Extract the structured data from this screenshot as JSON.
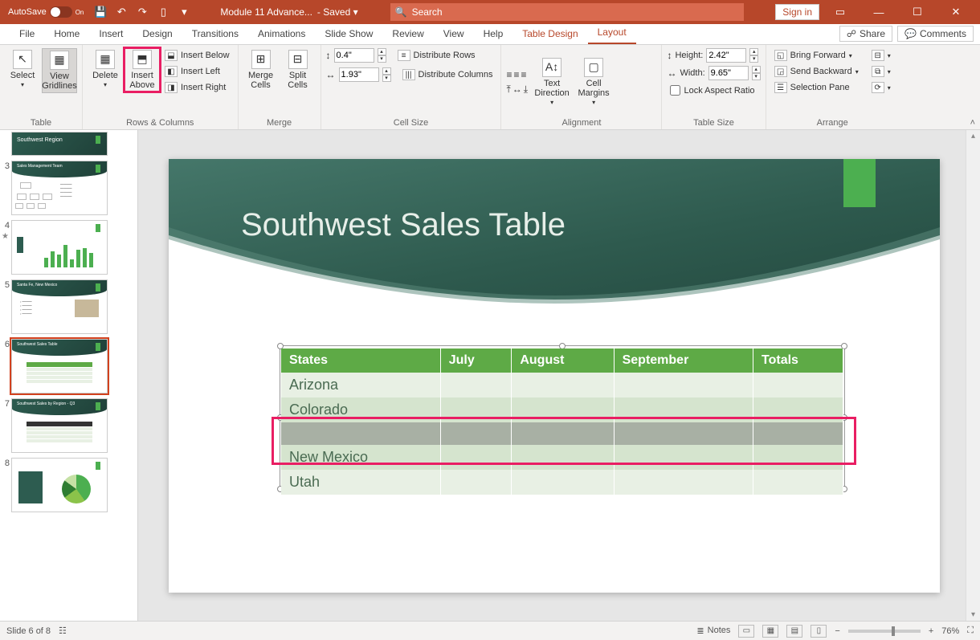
{
  "titlebar": {
    "autosave_label": "AutoSave",
    "autosave_state": "On",
    "doc_name": "Module 11 Advance...",
    "save_state": "- Saved ▾",
    "search_placeholder": "Search",
    "sign_in": "Sign in"
  },
  "tabs": {
    "items": [
      "File",
      "Home",
      "Insert",
      "Design",
      "Transitions",
      "Animations",
      "Slide Show",
      "Review",
      "View",
      "Help",
      "Table Design",
      "Layout"
    ],
    "active": "Layout",
    "share": "Share",
    "comments": "Comments"
  },
  "ribbon": {
    "table": {
      "select": "Select",
      "view_gridlines": "View Gridlines",
      "label": "Table"
    },
    "rows_cols": {
      "delete": "Delete",
      "insert_above": "Insert Above",
      "insert_below": "Insert Below",
      "insert_left": "Insert Left",
      "insert_right": "Insert Right",
      "label": "Rows & Columns"
    },
    "merge": {
      "merge": "Merge Cells",
      "split": "Split Cells",
      "label": "Merge"
    },
    "cell_size": {
      "height": "0.4\"",
      "width": "1.93\"",
      "dist_rows": "Distribute Rows",
      "dist_cols": "Distribute Columns",
      "label": "Cell Size"
    },
    "alignment": {
      "text_dir": "Text Direction",
      "cell_margins": "Cell Margins",
      "label": "Alignment"
    },
    "table_size": {
      "height_label": "Height:",
      "height": "2.42\"",
      "width_label": "Width:",
      "width": "9.65\"",
      "lock": "Lock Aspect Ratio",
      "label": "Table Size"
    },
    "arrange": {
      "bring_fwd": "Bring Forward",
      "send_back": "Send Backward",
      "sel_pane": "Selection Pane",
      "label": "Arrange"
    }
  },
  "thumbs": [
    {
      "num": "",
      "type": "dark-title",
      "title": "Southwest Region"
    },
    {
      "num": "3",
      "type": "org",
      "title": "Sales Management Team"
    },
    {
      "num": "4",
      "type": "chart",
      "star": true,
      "title": ""
    },
    {
      "num": "5",
      "type": "info",
      "title": "Santa Fe, New Mexico"
    },
    {
      "num": "6",
      "type": "table",
      "selected": true,
      "title": "Southwest Sales Table"
    },
    {
      "num": "7",
      "type": "table2",
      "title": "Southwest Sales by Region - Q3"
    },
    {
      "num": "8",
      "type": "pie",
      "title": ""
    }
  ],
  "slide": {
    "title": "Southwest Sales Table",
    "columns": [
      "States",
      "July",
      "August",
      "September",
      "Totals"
    ],
    "rows": [
      {
        "cells": [
          "Arizona",
          "",
          "",
          "",
          ""
        ],
        "band": "light"
      },
      {
        "cells": [
          "Colorado",
          "",
          "",
          "",
          ""
        ],
        "band": "dark"
      },
      {
        "cells": [
          "",
          "",
          "",
          "",
          ""
        ],
        "band": "sel"
      },
      {
        "cells": [
          "New Mexico",
          "",
          "",
          "",
          ""
        ],
        "band": "dark"
      },
      {
        "cells": [
          "Utah",
          "",
          "",
          "",
          ""
        ],
        "band": "light"
      }
    ]
  },
  "status": {
    "slide_counter": "Slide 6 of 8",
    "notes": "Notes",
    "zoom": "76%"
  },
  "chart_data": null
}
